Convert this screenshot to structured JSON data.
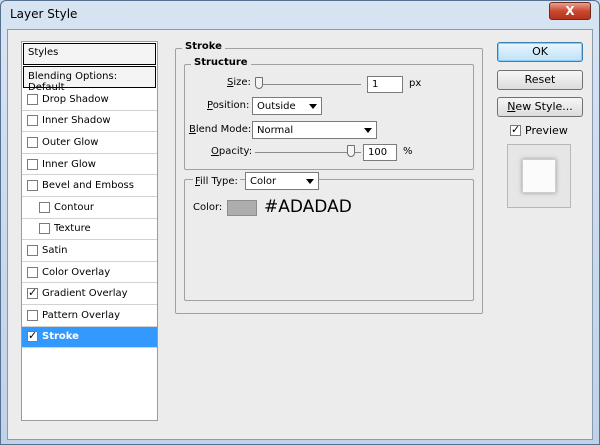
{
  "window": {
    "title": "Layer Style",
    "close_label": "X"
  },
  "styles_panel": {
    "header": "Styles",
    "blending_options": "Blending Options: Default",
    "items": [
      {
        "label": "Drop Shadow",
        "checked": false
      },
      {
        "label": "Inner Shadow",
        "checked": false
      },
      {
        "label": "Outer Glow",
        "checked": false
      },
      {
        "label": "Inner Glow",
        "checked": false
      },
      {
        "label": "Bevel and Emboss",
        "checked": false
      },
      {
        "label": "Contour",
        "checked": false
      },
      {
        "label": "Texture",
        "checked": false
      },
      {
        "label": "Satin",
        "checked": false
      },
      {
        "label": "Color Overlay",
        "checked": false
      },
      {
        "label": "Gradient Overlay",
        "checked": true
      },
      {
        "label": "Pattern Overlay",
        "checked": false
      },
      {
        "label": "Stroke",
        "checked": true
      }
    ]
  },
  "stroke": {
    "title": "Stroke",
    "structure": {
      "title": "Structure",
      "size_label": "Size:",
      "size_value": "1",
      "size_unit": "px",
      "position_label": "Position:",
      "position_value": "Outside",
      "blend_mode_label": "Blend Mode:",
      "blend_mode_value": "Normal",
      "opacity_label": "Opacity:",
      "opacity_value": "100",
      "opacity_unit": "%"
    },
    "fill": {
      "fill_type_label": "Fill Type:",
      "fill_type_value": "Color",
      "color_label": "Color:",
      "color_hex": "#ADADAD"
    }
  },
  "buttons": {
    "ok": "OK",
    "reset": "Reset",
    "new_style": "New Style..."
  },
  "preview": {
    "label": "Preview",
    "checked": true
  },
  "colors": {
    "swatch": "#adadad",
    "selection": "#3399ff"
  }
}
